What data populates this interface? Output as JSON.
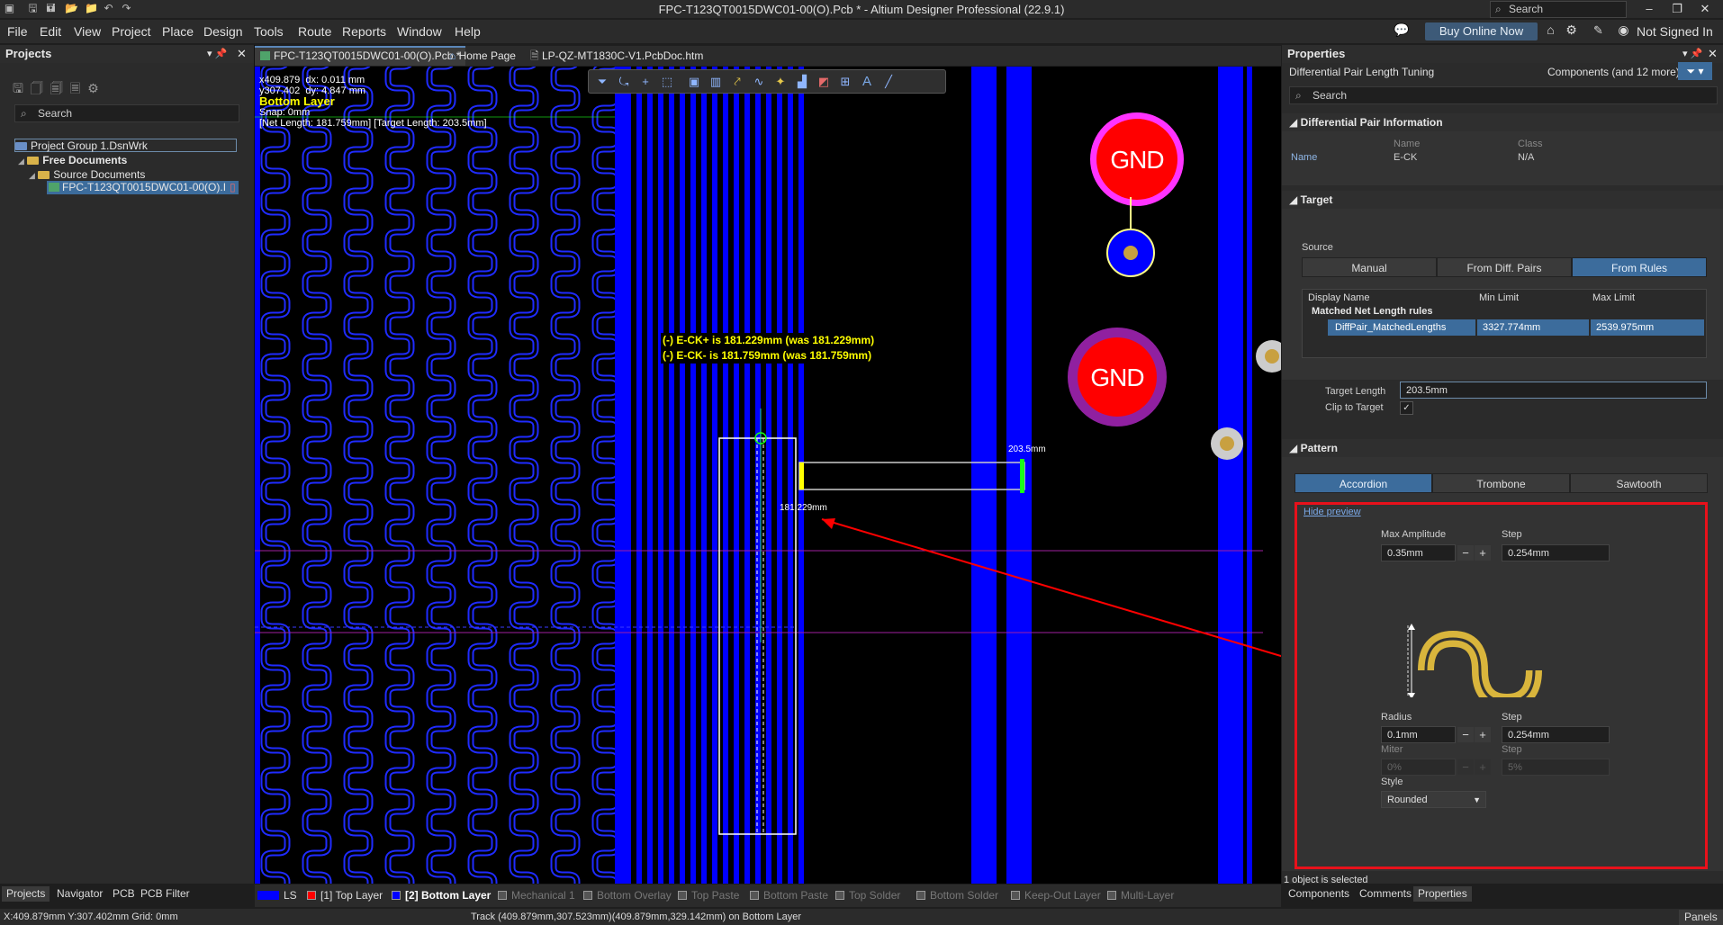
{
  "window": {
    "title": "FPC-T123QT0015DWC01-00(O).Pcb * - Altium Designer Professional (22.9.1)",
    "search_placeholder": "Search"
  },
  "menu": [
    "File",
    "Edit",
    "View",
    "Project",
    "Place",
    "Design",
    "Tools",
    "Route",
    "Reports",
    "Window",
    "Help"
  ],
  "menu_right": {
    "buy": "Buy Online Now",
    "signin": "Not Signed In"
  },
  "projects_panel": {
    "title": "Projects",
    "search_placeholder": "Search",
    "tree": [
      "Project Group 1.DsnWrk",
      "Free Documents",
      "Source Documents",
      "FPC-T123QT0015DWC01-00(O).I"
    ],
    "bottom_tabs": [
      "Projects",
      "Navigator",
      "PCB",
      "PCB Filter"
    ]
  },
  "doc_tabs": [
    "FPC-T123QT0015DWC01-00(O).Pcb *",
    "Home Page",
    "LP-QZ-MT1830C-V1.PcbDoc.htm"
  ],
  "canvas": {
    "coord_x": "x409.879",
    "coord_y": "y307.402",
    "dx": "dx: 0.011  mm",
    "dy": "dy: 4.847  mm",
    "layer": "Bottom Layer",
    "snap": "Snap: 0mm",
    "lengths": "[Net Length: 181.759mm] [Target Length: 203.5mm]",
    "msg_pos": "(-) E-CK+ is 181.229mm (was 181.229mm)",
    "msg_neg": "(-) E-CK- is 181.759mm (was 181.759mm)",
    "target_label": "203.5mm",
    "current_label": "181.229mm",
    "gnd1": "GND",
    "gnd2": "GND"
  },
  "layers": [
    {
      "name": "LS",
      "color": "#ffffff",
      "active": false
    },
    {
      "name": "[1] Top Layer",
      "color": "#ff0000",
      "active": false
    },
    {
      "name": "[2] Bottom Layer",
      "color": "#0000ff",
      "active": true
    },
    {
      "name": "Mechanical 1",
      "color": "#555555",
      "active": false
    },
    {
      "name": "Bottom Overlay",
      "color": "#555555",
      "active": false
    },
    {
      "name": "Top Paste",
      "color": "#555555",
      "active": false
    },
    {
      "name": "Bottom Paste",
      "color": "#555555",
      "active": false
    },
    {
      "name": "Top Solder",
      "color": "#555555",
      "active": false
    },
    {
      "name": "Bottom Solder",
      "color": "#555555",
      "active": false
    },
    {
      "name": "Keep-Out Layer",
      "color": "#555555",
      "active": false
    },
    {
      "name": "Multi-Layer",
      "color": "#555555",
      "active": false
    }
  ],
  "properties": {
    "title": "Properties",
    "object": "Differential Pair Length Tuning",
    "filter": "Components (and 12 more)",
    "search_placeholder": "Search",
    "diff_section": "Differential Pair Information",
    "name_label": "Name",
    "col_name": "Name",
    "col_class": "Class",
    "pair_name": "E-CK",
    "pair_class": "N/A",
    "target_section": "Target",
    "source_label": "Source",
    "source_options": [
      "Manual",
      "From Diff. Pairs",
      "From Rules"
    ],
    "source_selected": "From Rules",
    "grid_headers": [
      "Display Name",
      "Min Limit",
      "Max Limit"
    ],
    "rule_group": "Matched Net Length rules",
    "rule_name": "DiffPair_MatchedLengths",
    "rule_min": "3327.774mm",
    "rule_max": "2539.975mm",
    "target_length_label": "Target Length",
    "target_length": "203.5mm",
    "clip_label": "Clip to Target",
    "pattern_section": "Pattern",
    "pattern_options": [
      "Accordion",
      "Trombone",
      "Sawtooth"
    ],
    "pattern_selected": "Accordion",
    "hide_preview": "Hide preview",
    "max_amp_label": "Max Amplitude",
    "max_amp": "0.35mm",
    "step_label": "Step",
    "step1": "0.254mm",
    "radius_label": "Radius",
    "radius": "0.1mm",
    "step2": "0.254mm",
    "miter_label": "Miter",
    "miter": "0%",
    "step3": "5%",
    "style_label": "Style",
    "style": "Rounded",
    "selected_info": "1 object is selected",
    "bottom_tabs": [
      "Components",
      "Comments",
      "Properties"
    ]
  },
  "status": {
    "coords": "X:409.879mm Y:307.402mm   Grid: 0mm",
    "track": "Track (409.879mm,307.523mm)(409.879mm,329.142mm) on Bottom Layer",
    "panels": "Panels"
  }
}
